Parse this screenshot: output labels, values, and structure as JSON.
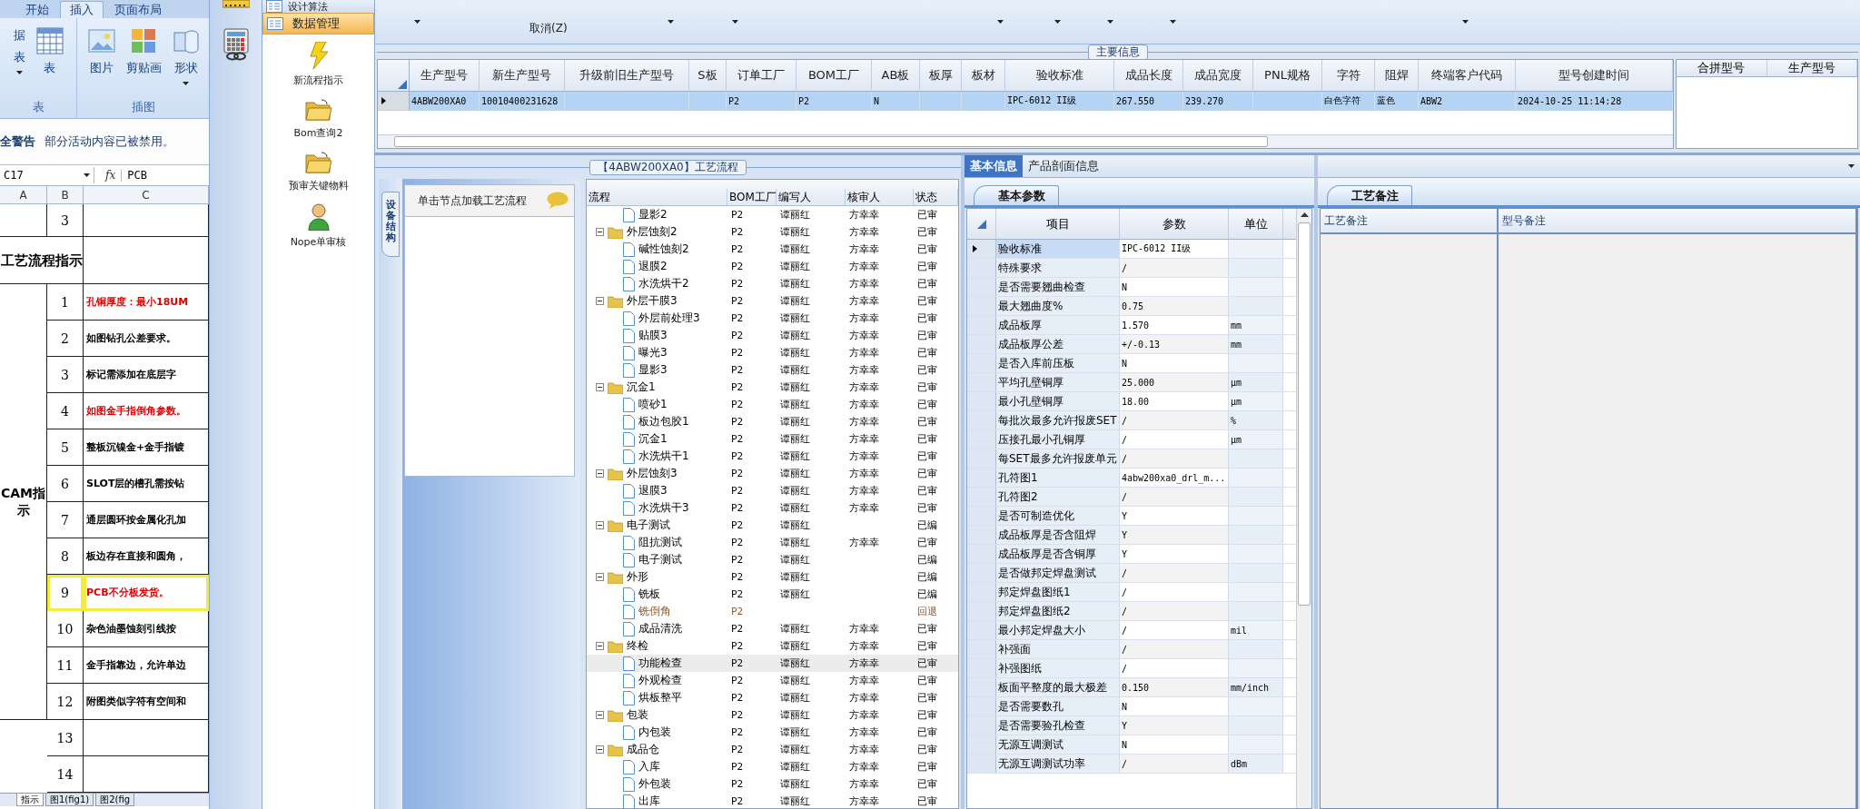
{
  "excel": {
    "ribbon_tabs": [
      {
        "label": "开始",
        "selected": false
      },
      {
        "label": "插入",
        "selected": true
      },
      {
        "label": "页面布局",
        "selected": false
      }
    ],
    "ribbon_groups": [
      {
        "label": "表",
        "buttons": [
          {
            "kind": "cut",
            "label": "据",
            "sublabel": "表"
          },
          {
            "kind": "table",
            "label": "表"
          }
        ]
      },
      {
        "label": "插图",
        "buttons": [
          {
            "kind": "picture",
            "label": "图片"
          },
          {
            "kind": "clipart",
            "label": "剪贴画"
          },
          {
            "kind": "shapes",
            "label": "形状"
          }
        ]
      }
    ],
    "warning": {
      "title": "全警告",
      "message": "部分活动内容已被禁用。"
    },
    "formula_bar": {
      "cell": "C17",
      "function_label": "fx",
      "value": "PCB"
    },
    "columns": [
      "A",
      "B",
      "C"
    ],
    "top_row": {
      "num": "3"
    },
    "section_title": "工艺流程指示",
    "group_label": "CAM指示",
    "rows": [
      {
        "num": "1",
        "text": "孔铜厚度：最小18UM",
        "emphasis": true,
        "highlighted": false
      },
      {
        "num": "2",
        "text": "如图钻孔公差要求。",
        "emphasis": false,
        "highlighted": false
      },
      {
        "num": "3",
        "text": "标记需添加在底层字",
        "emphasis": false,
        "highlighted": false
      },
      {
        "num": "4",
        "text": "如图金手指倒角参数。",
        "emphasis": true,
        "highlighted": false
      },
      {
        "num": "5",
        "text": "整板沉镍金+金手指镀",
        "emphasis": false,
        "highlighted": false
      },
      {
        "num": "6",
        "text": "SLOT层的槽孔需按钻",
        "emphasis": false,
        "highlighted": false
      },
      {
        "num": "7",
        "text": "通层圆环按金属化孔加",
        "emphasis": false,
        "highlighted": false
      },
      {
        "num": "8",
        "text": "板边存在直接和圆角，",
        "emphasis": false,
        "highlighted": false
      },
      {
        "num": "9",
        "text": "PCB不分板发货。",
        "emphasis": true,
        "highlighted": true
      },
      {
        "num": "10",
        "text": "杂色油墨蚀刻引线按",
        "emphasis": false,
        "highlighted": false
      },
      {
        "num": "11",
        "text": "金手指靠边，允许单边",
        "emphasis": false,
        "highlighted": false
      },
      {
        "num": "12",
        "text": "附图类似字符有空间和",
        "emphasis": false,
        "highlighted": false
      },
      {
        "num": "13",
        "highlighted": false
      },
      {
        "num": "14",
        "highlighted": false
      }
    ],
    "sheet_tabs": [
      {
        "label": "指示",
        "selected": true
      },
      {
        "label": "图1(fig1)",
        "selected": false
      },
      {
        "label": "图2(fig",
        "selected": false
      }
    ]
  },
  "nav": {
    "section": "设计算法",
    "header": "数据管理",
    "items": [
      {
        "kind": "bolt",
        "label": "新流程指示"
      },
      {
        "kind": "folder",
        "label": "Bom查询2"
      },
      {
        "kind": "folder",
        "label": "预审关键物料"
      },
      {
        "kind": "person",
        "label": "Nope单审核"
      }
    ]
  },
  "toolbar": {
    "cancel": "取消(Z)"
  },
  "main_info": {
    "title": "主要信息",
    "columns": [
      "生产型号",
      "新生产型号",
      "升级前旧生产型号",
      "S板",
      "订单工厂",
      "BOM工厂",
      "AB板",
      "板厚",
      "板材",
      "验收标准",
      "成品长度",
      "成品宽度",
      "PNL规格",
      "字符",
      "阻焊",
      "终端客户代码",
      "型号创建时间"
    ],
    "rows": [
      {
        "selected": true,
        "cells": [
          "4ABW200XA0",
          "10010400231628",
          "",
          "",
          "P2",
          "P2",
          "N",
          "",
          "",
          "IPC-6012 II级",
          "267.550",
          "239.270",
          "",
          "白色字符",
          "蓝色",
          "ABW2",
          "2024-10-25 11:14:28"
        ]
      }
    ],
    "side_columns": [
      "合拼型号",
      "生产型号"
    ]
  },
  "process": {
    "title": "【4ABW200XA0】工艺流程",
    "side_tab": "设备结构",
    "hint": "单击节点加载工艺流程",
    "columns": [
      "流程",
      "BOM工厂",
      "编写人",
      "核审人",
      "状态"
    ],
    "tree": [
      {
        "children": [
          {
            "name": "显影2",
            "bom": "P2",
            "writer": "谭丽红",
            "reviewer": "方幸幸",
            "status": "已审",
            "selected": false,
            "returned": false
          }
        ]
      },
      {
        "name": "外层蚀刻2",
        "bom": "P2",
        "writer": "谭丽红",
        "reviewer": "方幸幸",
        "status": "已审",
        "selected": false,
        "returned": false,
        "expanded": true,
        "children": [
          {
            "name": "碱性蚀刻2",
            "bom": "P2",
            "writer": "谭丽红",
            "reviewer": "方幸幸",
            "status": "已审",
            "selected": false,
            "returned": false
          },
          {
            "name": "退膜2",
            "bom": "P2",
            "writer": "谭丽红",
            "reviewer": "方幸幸",
            "status": "已审",
            "selected": false,
            "returned": false
          },
          {
            "name": "水洗烘干2",
            "bom": "P2",
            "writer": "谭丽红",
            "reviewer": "方幸幸",
            "status": "已审",
            "selected": false,
            "returned": false
          }
        ]
      },
      {
        "name": "外层干膜3",
        "bom": "P2",
        "writer": "谭丽红",
        "reviewer": "方幸幸",
        "status": "已审",
        "selected": false,
        "returned": false,
        "expanded": true,
        "children": [
          {
            "name": "外层前处理3",
            "bom": "P2",
            "writer": "谭丽红",
            "reviewer": "方幸幸",
            "status": "已审",
            "selected": false,
            "returned": false
          },
          {
            "name": "贴膜3",
            "bom": "P2",
            "writer": "谭丽红",
            "reviewer": "方幸幸",
            "status": "已审",
            "selected": false,
            "returned": false
          },
          {
            "name": "曝光3",
            "bom": "P2",
            "writer": "谭丽红",
            "reviewer": "方幸幸",
            "status": "已审",
            "selected": false,
            "returned": false
          },
          {
            "name": "显影3",
            "bom": "P2",
            "writer": "谭丽红",
            "reviewer": "方幸幸",
            "status": "已审",
            "selected": false,
            "returned": false
          }
        ]
      },
      {
        "name": "沉金1",
        "bom": "P2",
        "writer": "谭丽红",
        "reviewer": "方幸幸",
        "status": "已审",
        "selected": false,
        "returned": false,
        "expanded": true,
        "children": [
          {
            "name": "喷砂1",
            "bom": "P2",
            "writer": "谭丽红",
            "reviewer": "方幸幸",
            "status": "已审",
            "selected": false,
            "returned": false
          },
          {
            "name": "板边包胶1",
            "bom": "P2",
            "writer": "谭丽红",
            "reviewer": "方幸幸",
            "status": "已审",
            "selected": false,
            "returned": false
          },
          {
            "name": "沉金1",
            "bom": "P2",
            "writer": "谭丽红",
            "reviewer": "方幸幸",
            "status": "已审",
            "selected": false,
            "returned": false
          },
          {
            "name": "水洗烘干1",
            "bom": "P2",
            "writer": "谭丽红",
            "reviewer": "方幸幸",
            "status": "已审",
            "selected": false,
            "returned": false
          }
        ]
      },
      {
        "name": "外层蚀刻3",
        "bom": "P2",
        "writer": "谭丽红",
        "reviewer": "方幸幸",
        "status": "已审",
        "selected": false,
        "returned": false,
        "expanded": true,
        "children": [
          {
            "name": "退膜3",
            "bom": "P2",
            "writer": "谭丽红",
            "reviewer": "方幸幸",
            "status": "已审",
            "selected": false,
            "returned": false
          },
          {
            "name": "水洗烘干3",
            "bom": "P2",
            "writer": "谭丽红",
            "reviewer": "方幸幸",
            "status": "已审",
            "selected": false,
            "returned": false
          }
        ]
      },
      {
        "name": "电子测试",
        "bom": "P2",
        "writer": "谭丽红",
        "status": "已编",
        "selected": false,
        "returned": false,
        "expanded": true,
        "children": [
          {
            "name": "阻抗测试",
            "bom": "P2",
            "writer": "谭丽红",
            "reviewer": "方幸幸",
            "status": "已审",
            "selected": false,
            "returned": false
          },
          {
            "name": "电子测试",
            "bom": "P2",
            "writer": "谭丽红",
            "status": "已编",
            "selected": false,
            "returned": false
          }
        ]
      },
      {
        "name": "外形",
        "bom": "P2",
        "writer": "谭丽红",
        "status": "已编",
        "selected": false,
        "returned": false,
        "expanded": true,
        "children": [
          {
            "name": "铣板",
            "bom": "P2",
            "writer": "谭丽红",
            "status": "已编",
            "selected": false,
            "returned": false
          },
          {
            "name": "铣倒角",
            "bom": "P2",
            "status": "回退",
            "selected": false,
            "returned": true
          },
          {
            "name": "成品清洗",
            "bom": "P2",
            "writer": "谭丽红",
            "reviewer": "方幸幸",
            "status": "已审",
            "selected": false,
            "returned": false
          }
        ]
      },
      {
        "name": "终检",
        "bom": "P2",
        "writer": "谭丽红",
        "reviewer": "方幸幸",
        "status": "已审",
        "selected": false,
        "returned": false,
        "expanded": true,
        "children": [
          {
            "name": "功能检查",
            "bom": "P2",
            "writer": "谭丽红",
            "reviewer": "方幸幸",
            "status": "已审",
            "selected": true,
            "returned": false
          },
          {
            "name": "外观检查",
            "bom": "P2",
            "writer": "谭丽红",
            "reviewer": "方幸幸",
            "status": "已审",
            "selected": false,
            "returned": false
          },
          {
            "name": "烘板整平",
            "bom": "P2",
            "writer": "谭丽红",
            "reviewer": "方幸幸",
            "status": "已审",
            "selected": false,
            "returned": false
          }
        ]
      },
      {
        "name": "包装",
        "bom": "P2",
        "writer": "谭丽红",
        "reviewer": "方幸幸",
        "status": "已审",
        "selected": false,
        "returned": false,
        "expanded": true,
        "children": [
          {
            "name": "内包装",
            "bom": "P2",
            "writer": "谭丽红",
            "reviewer": "方幸幸",
            "status": "已审",
            "selected": false,
            "returned": false
          }
        ]
      },
      {
        "name": "成品仓",
        "bom": "P2",
        "writer": "谭丽红",
        "reviewer": "方幸幸",
        "status": "已审",
        "selected": false,
        "returned": false,
        "expanded": true,
        "children": [
          {
            "name": "入库",
            "bom": "P2",
            "writer": "谭丽红",
            "reviewer": "方幸幸",
            "status": "已审",
            "selected": false,
            "returned": false
          },
          {
            "name": "外包装",
            "bom": "P2",
            "writer": "谭丽红",
            "reviewer": "方幸幸",
            "status": "已审",
            "selected": false,
            "returned": false
          },
          {
            "name": "出库",
            "bom": "P2",
            "writer": "谭丽红",
            "reviewer": "方幸幸",
            "status": "已审",
            "selected": false,
            "returned": false
          }
        ]
      }
    ]
  },
  "basic": {
    "tabs": [
      {
        "label": "基本信息",
        "selected": true
      },
      {
        "label": "产品剖面信息",
        "selected": false
      }
    ],
    "sub_tab": "基本参数",
    "columns": [
      "项目",
      "参数",
      "单位"
    ],
    "rows": [
      {
        "item": "验收标准",
        "value": "IPC-6012 II级",
        "selected": true
      },
      {
        "item": "特殊要求",
        "value": "/",
        "selected": false
      },
      {
        "item": "是否需要翘曲检查",
        "value": "N",
        "selected": false
      },
      {
        "item": "最大翘曲度%",
        "value": "0.75",
        "selected": false
      },
      {
        "item": "成品板厚",
        "value": "1.570",
        "unit": "mm",
        "selected": false
      },
      {
        "item": "成品板厚公差",
        "value": "+/-0.13",
        "unit": "mm",
        "selected": false
      },
      {
        "item": "是否入库前压板",
        "value": "N",
        "selected": false
      },
      {
        "item": "平均孔壁铜厚",
        "value": "25.000",
        "unit": "μm",
        "selected": false
      },
      {
        "item": "最小孔壁铜厚",
        "value": "18.00",
        "unit": "μm",
        "selected": false
      },
      {
        "item": "每批次最多允许报废SET",
        "value": "/",
        "unit": "%",
        "selected": false
      },
      {
        "item": "压接孔最小孔铜厚",
        "value": "/",
        "unit": "μm",
        "selected": false
      },
      {
        "item": "每SET最多允许报废单元",
        "value": "/",
        "selected": false
      },
      {
        "item": "孔符图1",
        "value": "4abw200xa0_drl_m...",
        "selected": false
      },
      {
        "item": "孔符图2",
        "value": "/",
        "selected": false
      },
      {
        "item": "是否可制造优化",
        "value": "Y",
        "selected": false
      },
      {
        "item": "成品板厚是否含阻焊",
        "value": "Y",
        "selected": false
      },
      {
        "item": "成品板厚是否含铜厚",
        "value": "Y",
        "selected": false
      },
      {
        "item": "是否做邦定焊盘测试",
        "value": "/",
        "selected": false
      },
      {
        "item": "邦定焊盘图纸1",
        "value": "/",
        "selected": false
      },
      {
        "item": "邦定焊盘图纸2",
        "value": "/",
        "selected": false
      },
      {
        "item": "最小邦定焊盘大小",
        "value": "/",
        "unit": "mil",
        "selected": false
      },
      {
        "item": "补强面",
        "value": "/",
        "selected": false
      },
      {
        "item": "补强图纸",
        "value": "/",
        "selected": false
      },
      {
        "item": "板面平整度的最大极差",
        "value": "0.150",
        "unit": "mm/inch",
        "selected": false
      },
      {
        "item": "是否需要数孔",
        "value": "N",
        "selected": false
      },
      {
        "item": "是否需要验孔检查",
        "value": "Y",
        "selected": false
      },
      {
        "item": "无源互调测试",
        "value": "N",
        "selected": false
      },
      {
        "item": "无源互调测试功率",
        "value": "/",
        "unit": "dBm",
        "selected": false
      }
    ]
  },
  "remarks": {
    "sub_tab": "工艺备注",
    "columns": [
      "工艺备注",
      "型号备注"
    ]
  }
}
